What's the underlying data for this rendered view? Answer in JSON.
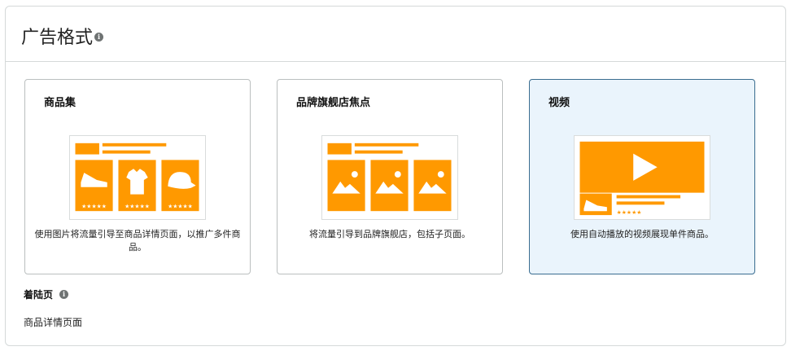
{
  "section": {
    "title": "广告格式",
    "info_icon": "info-icon"
  },
  "cards": [
    {
      "title": "商品集",
      "description": "使用图片将流量引导至商品详情页面，以推广多件商品。",
      "selected": false
    },
    {
      "title": "品牌旗舰店焦点",
      "description": "将流量引导到品牌旗舰店，包括子页面。",
      "selected": false
    },
    {
      "title": "视频",
      "description": "使用自动播放的视频展现单件商品。",
      "selected": true
    }
  ],
  "landing_page": {
    "label": "着陆页",
    "value": "商品详情页面"
  },
  "colors": {
    "accent_orange": "#ff9900",
    "selected_bg": "#eaf4fc",
    "selected_border": "#3a6d90",
    "border": "#d5d9d9"
  }
}
